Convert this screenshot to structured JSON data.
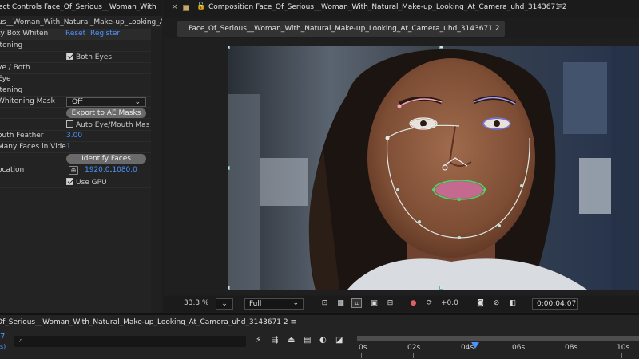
{
  "effect_controls": {
    "tab_title": "ect Controls Face_Of_Serious__Woman_With",
    "layer_name": "us__Woman_With_Natural_Make-up_Looking_At",
    "effect_name": "ty Box Whiten",
    "reset_label": "Reset",
    "register_label": "Register",
    "rows": {
      "r1": "itening",
      "both_eyes": "Both Eyes",
      "r3": "ye / Both",
      "r4": "Eye",
      "r5": "itening",
      "whitening_mask": "Whitening Mask",
      "whitening_mask_value": "Off",
      "export_button": "Export to AE Masks",
      "auto_eye_mouth": "Auto Eye/Mouth Mas",
      "mouth_feather": "outh Feather",
      "mouth_feather_value": "3.00",
      "many_faces": "Many Faces in Vide",
      "many_faces_value": "1",
      "identify_button": "Identify Faces",
      "location": "ocation",
      "location_x": "1920.0",
      "location_sep": ",",
      "location_y": "1080.0",
      "use_gpu": "Use GPU"
    }
  },
  "composition": {
    "close": "×",
    "lock": "🔓",
    "title": "Composition Face_Of_Serious__Woman_With_Natural_Make-up_Looking_At_Camera_uhd_3143671 2",
    "menu": "≡",
    "subtab": "Face_Of_Serious__Woman_With_Natural_Make-up_Looking_At_Camera_uhd_3143671 2"
  },
  "viewer_toolbar": {
    "zoom": "33.3",
    "zoom_unit": "%",
    "resolution": "Full",
    "exposure": "+0.0",
    "timecode": "0:00:04:07"
  },
  "timeline": {
    "tab_title": "Of_Serious__Woman_With_Natural_Make-up_Looking_At_Camera_uhd_3143671 2",
    "menu": "≡",
    "current_frame": "7",
    "fps_hint": "s)",
    "search_placeholder": "",
    "ruler_labels": [
      "0s",
      "02s",
      "04s",
      "06s",
      "08s",
      "10s"
    ]
  }
}
